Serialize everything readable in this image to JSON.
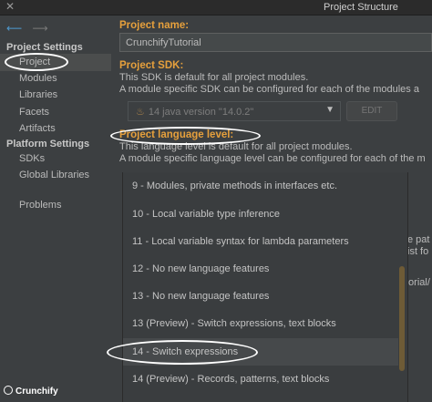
{
  "window": {
    "title": "Project Structure"
  },
  "sidebar": {
    "project_settings_label": "Project Settings",
    "project_settings_items": [
      {
        "label": "Project",
        "selected": true
      },
      {
        "label": "Modules"
      },
      {
        "label": "Libraries"
      },
      {
        "label": "Facets"
      },
      {
        "label": "Artifacts"
      }
    ],
    "platform_settings_label": "Platform Settings",
    "platform_settings_items": [
      {
        "label": "SDKs"
      },
      {
        "label": "Global Libraries"
      }
    ],
    "problems_label": "Problems"
  },
  "main": {
    "project_name_label": "Project name:",
    "project_name_value": "CrunchifyTutorial",
    "sdk_label": "Project SDK:",
    "sdk_desc_1": "This SDK is default for all project modules.",
    "sdk_desc_2": "A module specific SDK can be configured for each of the modules a",
    "sdk_selected": "14 java version \"14.0.2\"",
    "edit_button": "EDIT",
    "language_level_label": "Project language level:",
    "language_desc_1": "This language level is default for all project modules.",
    "language_desc_2": "A module specific language level can be configured for each of the m",
    "right_clip_1": "e pat",
    "right_clip_2": "ist fo",
    "right_clip_3": "torial/"
  },
  "dropdown": {
    "options": [
      {
        "label": "9 - Modules, private methods in interfaces etc."
      },
      {
        "label": "10 - Local variable type inference"
      },
      {
        "label": "11 - Local variable syntax for lambda parameters"
      },
      {
        "label": "12 - No new language features"
      },
      {
        "label": "13 - No new language features"
      },
      {
        "label": "13 (Preview) - Switch expressions, text blocks"
      },
      {
        "label": "14 - Switch expressions",
        "highlighted": true
      },
      {
        "label": "14 (Preview) - Records, patterns, text blocks"
      }
    ]
  },
  "watermark": {
    "text": "Crunchify"
  },
  "colors": {
    "accent_label": "#e6a03c",
    "background": "#3c3f41",
    "scrollbar": "#6e5b36"
  }
}
